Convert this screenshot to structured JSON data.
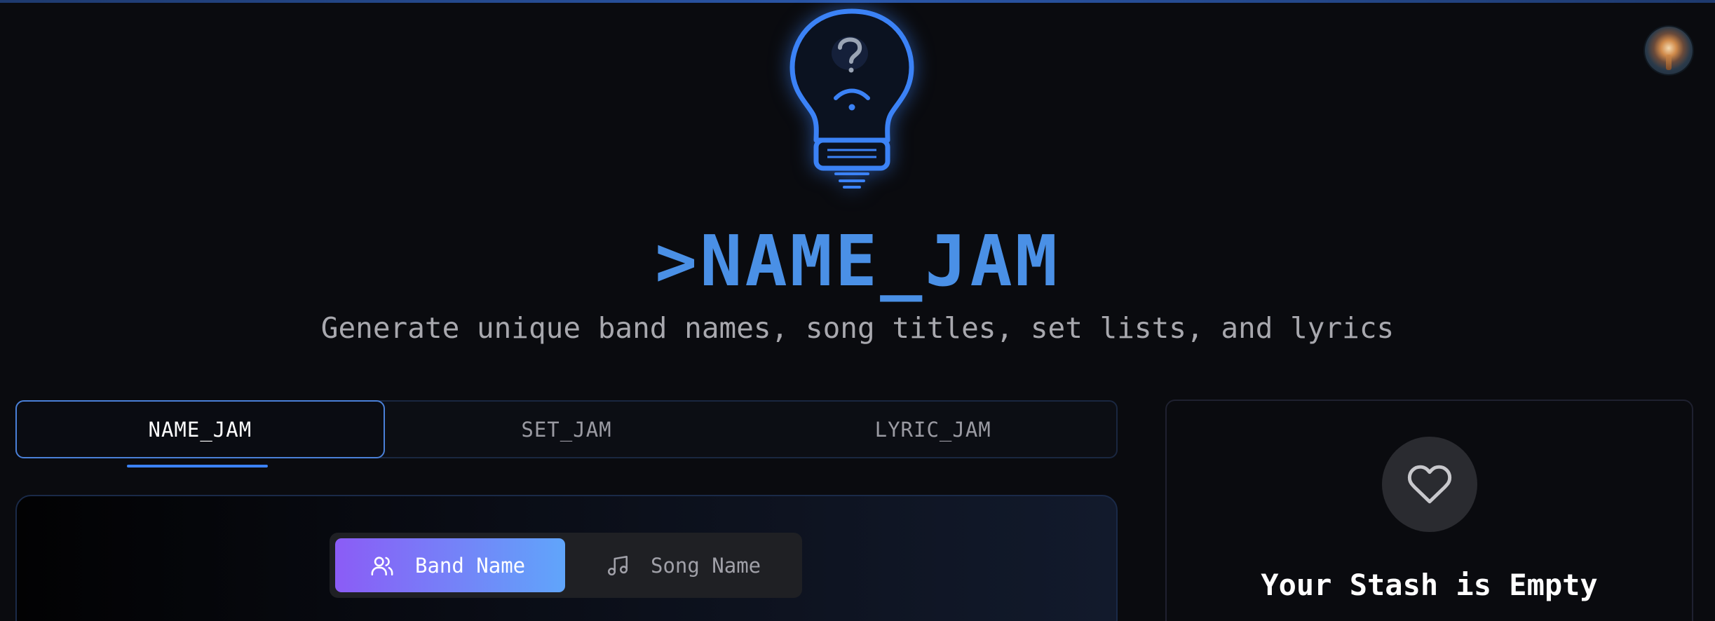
{
  "app": {
    "title": ">NAME_JAM",
    "subtitle": "Generate unique band names, song titles, set lists, and lyrics"
  },
  "tabs": [
    {
      "label": "NAME_JAM",
      "active": true
    },
    {
      "label": "SET_JAM",
      "active": false
    },
    {
      "label": "LYRIC_JAM",
      "active": false
    }
  ],
  "mode_toggle": {
    "band_label": "Band Name",
    "song_label": "Song Name",
    "selected": "Band Name"
  },
  "stash": {
    "title": "Your Stash is Empty"
  },
  "icons": {
    "logo": "lightbulb-question-icon",
    "band": "users-icon",
    "song": "music-note-icon",
    "stash": "heart-icon"
  },
  "colors": {
    "accent": "#4a90e6",
    "background": "#0a0b0f",
    "gradient_start": "#8b5cf6",
    "gradient_end": "#60a5fa"
  }
}
